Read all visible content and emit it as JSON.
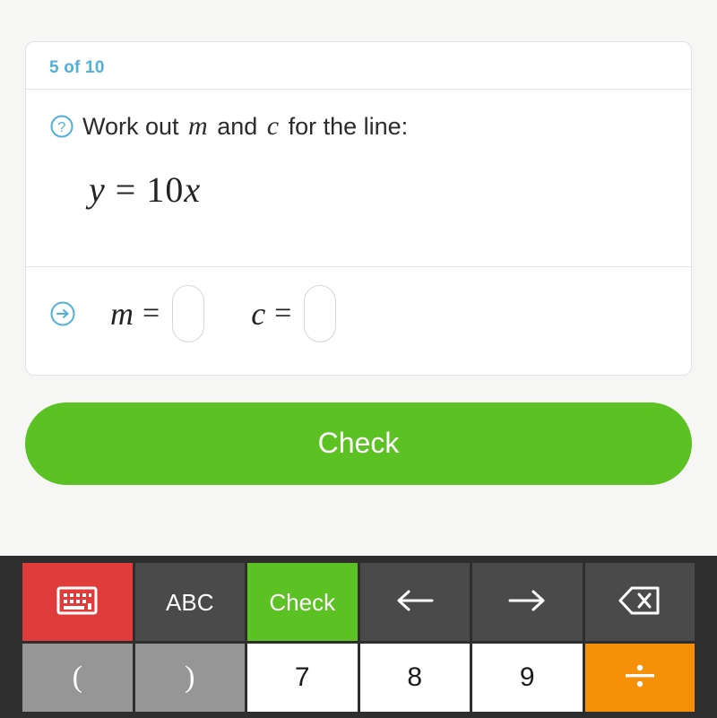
{
  "card": {
    "progress": "5 of 10",
    "question_icon": "question-circle-icon",
    "question_prefix": "Work out ",
    "question_var1": "m",
    "question_mid": " and ",
    "question_var2": "c",
    "question_suffix": " for the line:",
    "equation_lhs": "y",
    "equation_eq": "=",
    "equation_coefficient": "10",
    "equation_var": "x",
    "answer_icon": "arrow-circle-right-icon",
    "answer1_label": "m",
    "answer1_eq": "=",
    "answer1_value": "",
    "answer2_label": "c",
    "answer2_eq": "=",
    "answer2_value": ""
  },
  "check_button": {
    "label": "Check"
  },
  "keyboard": {
    "row1": [
      {
        "label": "",
        "icon": "keyboard-icon",
        "style": "red",
        "name": "key-keyboard-toggle"
      },
      {
        "label": "ABC",
        "icon": "",
        "style": "dark",
        "name": "key-abc"
      },
      {
        "label": "Check",
        "icon": "",
        "style": "green",
        "name": "key-check"
      },
      {
        "label": "←",
        "icon": "arrow-left-icon",
        "style": "dark",
        "name": "key-arrow-left"
      },
      {
        "label": "→",
        "icon": "arrow-right-icon",
        "style": "dark",
        "name": "key-arrow-right"
      },
      {
        "label": "",
        "icon": "backspace-icon",
        "style": "dark",
        "name": "key-backspace"
      }
    ],
    "row2": [
      {
        "label": "(",
        "icon": "",
        "style": "lgray",
        "name": "key-paren-open"
      },
      {
        "label": ")",
        "icon": "",
        "style": "lgray",
        "name": "key-paren-close"
      },
      {
        "label": "7",
        "icon": "",
        "style": "white",
        "name": "key-7"
      },
      {
        "label": "8",
        "icon": "",
        "style": "white",
        "name": "key-8"
      },
      {
        "label": "9",
        "icon": "",
        "style": "white",
        "name": "key-9"
      },
      {
        "label": "÷",
        "icon": "divide-icon",
        "style": "orange",
        "name": "key-divide"
      }
    ]
  },
  "colors": {
    "accent_blue": "#4fb0dc",
    "green": "#5cc123",
    "red": "#e03c3c",
    "orange": "#f79009",
    "keyboard_bg": "#2e2e2e",
    "key_dark": "#4a4a4a",
    "key_light_gray": "#969696",
    "page_bg": "#f6f6f4"
  }
}
